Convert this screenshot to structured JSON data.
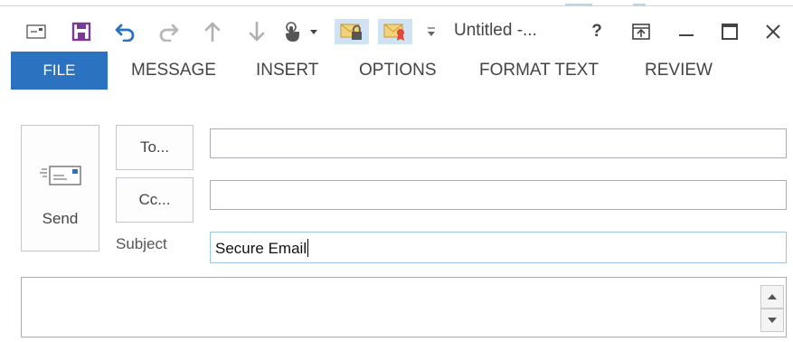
{
  "window": {
    "title": "Untitled -...",
    "help_label": "?",
    "controls": [
      "ribbon-display-options",
      "minimize",
      "maximize",
      "close"
    ]
  },
  "quick_access": {
    "icons": [
      "email-icon",
      "save-icon",
      "undo-icon",
      "redo-icon",
      "up-arrow-icon",
      "down-arrow-icon",
      "touch-mode-icon",
      "encrypt-icon",
      "digital-sign-icon",
      "customize-icon"
    ]
  },
  "ribbon": {
    "tabs": [
      "FILE",
      "MESSAGE",
      "INSERT",
      "OPTIONS",
      "FORMAT TEXT",
      "REVIEW"
    ],
    "active": "FILE"
  },
  "compose": {
    "send_label": "Send",
    "to_label": "To...",
    "cc_label": "Cc...",
    "to_value": "",
    "cc_value": "",
    "subject_label": "Subject",
    "subject_value": "Secure Email",
    "body_value": ""
  },
  "colors": {
    "accent": "#2b73c1",
    "selected_bg": "#cfe3f5",
    "save_icon": "#7a3b95"
  }
}
